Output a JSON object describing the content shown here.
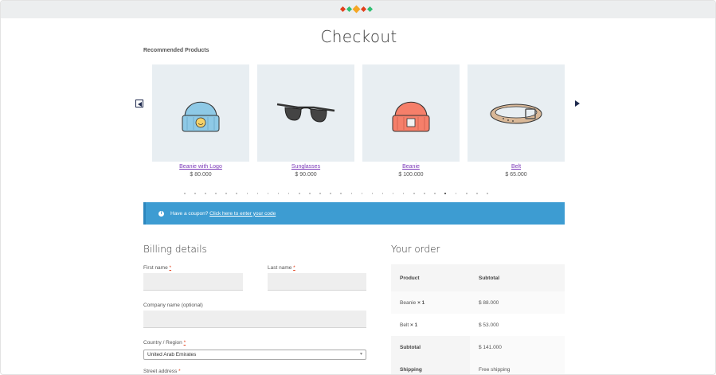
{
  "colors": {
    "accent": "#3d9cd2",
    "link": "#7b38b8",
    "required": "#e2401c",
    "dots": [
      "#e2401c",
      "#2fbf71",
      "#f5a623",
      "#e2401c",
      "#2fbf71"
    ]
  },
  "page": {
    "title": "Checkout"
  },
  "recommended": {
    "title": "Recommended Products",
    "products": [
      {
        "name": "Beanie with Logo",
        "price": "$ 80.000",
        "icon": "beanie-with-logo-image"
      },
      {
        "name": "Sunglasses",
        "price": "$ 90.000",
        "icon": "sunglasses-image"
      },
      {
        "name": "Beanie",
        "price": "$ 100.000",
        "icon": "beanie-image"
      },
      {
        "name": "Belt",
        "price": "$ 65.000",
        "icon": "belt-image"
      }
    ],
    "pager_count": 30,
    "pager_active": 25
  },
  "coupon": {
    "prefix": "Have a coupon?",
    "link": "Click here to enter your code"
  },
  "billing": {
    "title": "Billing details",
    "first_name_label": "First name",
    "last_name_label": "Last name",
    "company_label": "Company name (optional)",
    "country_label": "Country / Region",
    "country_value": "United Arab Emirates",
    "street_label": "Street address",
    "required_mark": "*"
  },
  "order": {
    "title": "Your order",
    "col_product": "Product",
    "col_subtotal": "Subtotal",
    "items": [
      {
        "name": "Beanie",
        "qty": "× 1",
        "subtotal": "$ 88.000"
      },
      {
        "name": "Belt",
        "qty": "× 1",
        "subtotal": "$ 53.000"
      }
    ],
    "subtotal_label": "Subtotal",
    "subtotal_value": "$ 141.000",
    "shipping_label": "Shipping",
    "shipping_value": "Free shipping"
  }
}
